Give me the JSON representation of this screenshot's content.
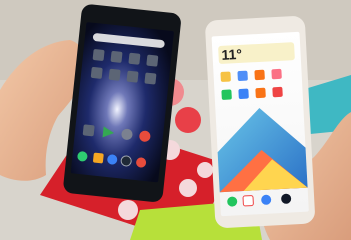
{
  "scene": {
    "left_phone": {
      "screen_theme": "dark",
      "top_apps": [
        "folder",
        "folder",
        "folder",
        "folder",
        "folder",
        "folder",
        "folder",
        "folder",
        "folder"
      ],
      "middle_apps": [
        "folder",
        "play-store",
        "settings",
        "chrome"
      ],
      "dock_apps": [
        "phone",
        "contacts",
        "messages",
        "camera",
        "chrome"
      ]
    },
    "right_phone": {
      "screen_theme": "light",
      "weather": {
        "temperature": "11°",
        "unit": "C"
      },
      "dock_apps": [
        "phone",
        "gmail",
        "browser",
        "camera"
      ]
    },
    "colors": {
      "background": "#d8d4cc",
      "table_red": "#d6202a",
      "teal": "#3fb8c3",
      "lime": "#b7e03a",
      "right_phone_body": "#efeae3",
      "left_phone_body": "#111418"
    }
  }
}
